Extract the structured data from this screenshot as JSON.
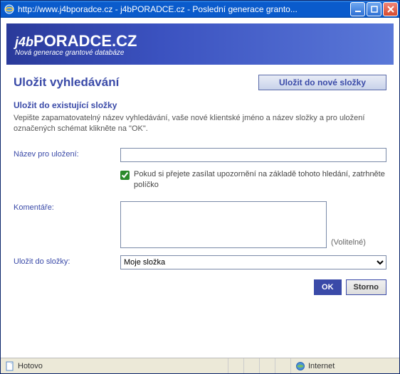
{
  "window": {
    "title": "http://www.j4bporadce.cz - j4bPORADCE.cz - Poslední generace granto..."
  },
  "banner": {
    "logo_prefix": "j4b",
    "logo_main": "PORADCE.CZ",
    "logo_sub": "Nová generace grantové databáze"
  },
  "page": {
    "title": "Uložit vyhledávání",
    "new_folder_btn": "Uložit do nové složky",
    "section_heading": "Uložit do existující složky",
    "instructions": "Vepište zapamatovatelný název vyhledávání, vaše nové klientské jméno a název složky a pro uložení označených schémat klikněte na \"OK\"."
  },
  "form": {
    "name_label": "Název pro uložení:",
    "name_value": "",
    "notify_checked": true,
    "notify_label": "Pokud si přejete zasílat upozornění na základě tohoto hledání, zatrhněte políčko",
    "comments_label": "Komentáře:",
    "comments_value": "",
    "optional_text": "(Volitelné)",
    "folder_label": "Uložit do složky:",
    "folder_selected": "Moje složka",
    "ok_label": "OK",
    "cancel_label": "Storno"
  },
  "statusbar": {
    "status_text": "Hotovo",
    "zone_text": "Internet"
  }
}
